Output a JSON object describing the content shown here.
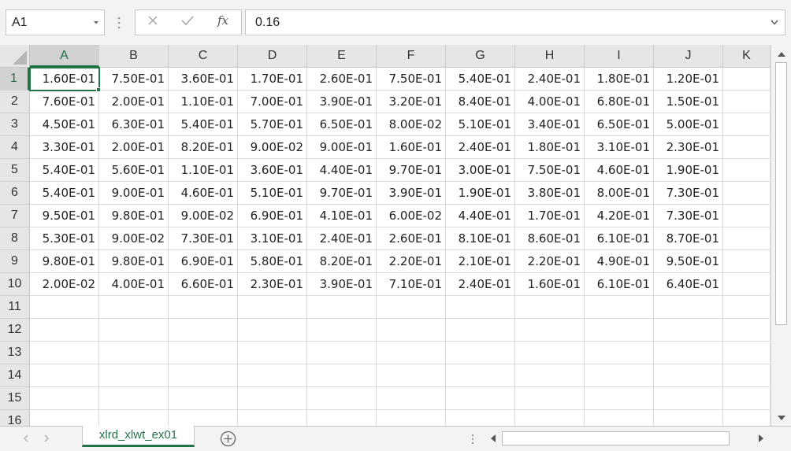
{
  "name_box": {
    "value": "A1"
  },
  "formula_bar": {
    "cancel_label": "✕",
    "enter_label": "✓",
    "fx_label": "fx",
    "value": "0.16"
  },
  "columns": [
    "A",
    "B",
    "C",
    "D",
    "E",
    "F",
    "G",
    "H",
    "I",
    "J",
    "K"
  ],
  "rows": [
    "1",
    "2",
    "3",
    "4",
    "5",
    "6",
    "7",
    "8",
    "9",
    "10",
    "11",
    "12",
    "13",
    "14",
    "15",
    "16"
  ],
  "cells": [
    [
      "1.60E-01",
      "7.50E-01",
      "3.60E-01",
      "1.70E-01",
      "2.60E-01",
      "7.50E-01",
      "5.40E-01",
      "2.40E-01",
      "1.80E-01",
      "1.20E-01"
    ],
    [
      "7.60E-01",
      "2.00E-01",
      "1.10E-01",
      "7.00E-01",
      "3.90E-01",
      "3.20E-01",
      "8.40E-01",
      "4.00E-01",
      "6.80E-01",
      "1.50E-01"
    ],
    [
      "4.50E-01",
      "6.30E-01",
      "5.40E-01",
      "5.70E-01",
      "6.50E-01",
      "8.00E-02",
      "5.10E-01",
      "3.40E-01",
      "6.50E-01",
      "5.00E-01"
    ],
    [
      "3.30E-01",
      "2.00E-01",
      "8.20E-01",
      "9.00E-02",
      "9.00E-01",
      "1.60E-01",
      "2.40E-01",
      "1.80E-01",
      "3.10E-01",
      "2.30E-01"
    ],
    [
      "5.40E-01",
      "5.60E-01",
      "1.10E-01",
      "3.60E-01",
      "4.40E-01",
      "9.70E-01",
      "3.00E-01",
      "7.50E-01",
      "4.60E-01",
      "1.90E-01"
    ],
    [
      "5.40E-01",
      "9.00E-01",
      "4.60E-01",
      "5.10E-01",
      "9.70E-01",
      "3.90E-01",
      "1.90E-01",
      "3.80E-01",
      "8.00E-01",
      "7.30E-01"
    ],
    [
      "9.50E-01",
      "9.80E-01",
      "9.00E-02",
      "6.90E-01",
      "4.10E-01",
      "6.00E-02",
      "4.40E-01",
      "1.70E-01",
      "4.20E-01",
      "7.30E-01"
    ],
    [
      "5.30E-01",
      "9.00E-02",
      "7.30E-01",
      "3.10E-01",
      "2.40E-01",
      "2.60E-01",
      "8.10E-01",
      "8.60E-01",
      "6.10E-01",
      "8.70E-01"
    ],
    [
      "9.80E-01",
      "9.80E-01",
      "6.90E-01",
      "5.80E-01",
      "8.20E-01",
      "2.20E-01",
      "2.10E-01",
      "2.20E-01",
      "4.90E-01",
      "9.50E-01"
    ],
    [
      "2.00E-02",
      "4.00E-01",
      "6.60E-01",
      "2.30E-01",
      "3.90E-01",
      "7.10E-01",
      "2.40E-01",
      "1.60E-01",
      "6.10E-01",
      "6.40E-01"
    ]
  ],
  "selected_cell": "A1",
  "sheet_tab": {
    "label": "xlrd_xlwt_ex01"
  },
  "icons": {
    "name_box_dropdown": "chevron-down-icon",
    "cancel": "close-icon",
    "enter": "check-icon",
    "function": "fx-icon",
    "formula_expand": "chevron-down-icon",
    "add_sheet": "plus-circle-icon"
  },
  "colors": {
    "accent": "#217346",
    "header_bg": "#e6e6e6",
    "grid_line": "#dadada"
  }
}
